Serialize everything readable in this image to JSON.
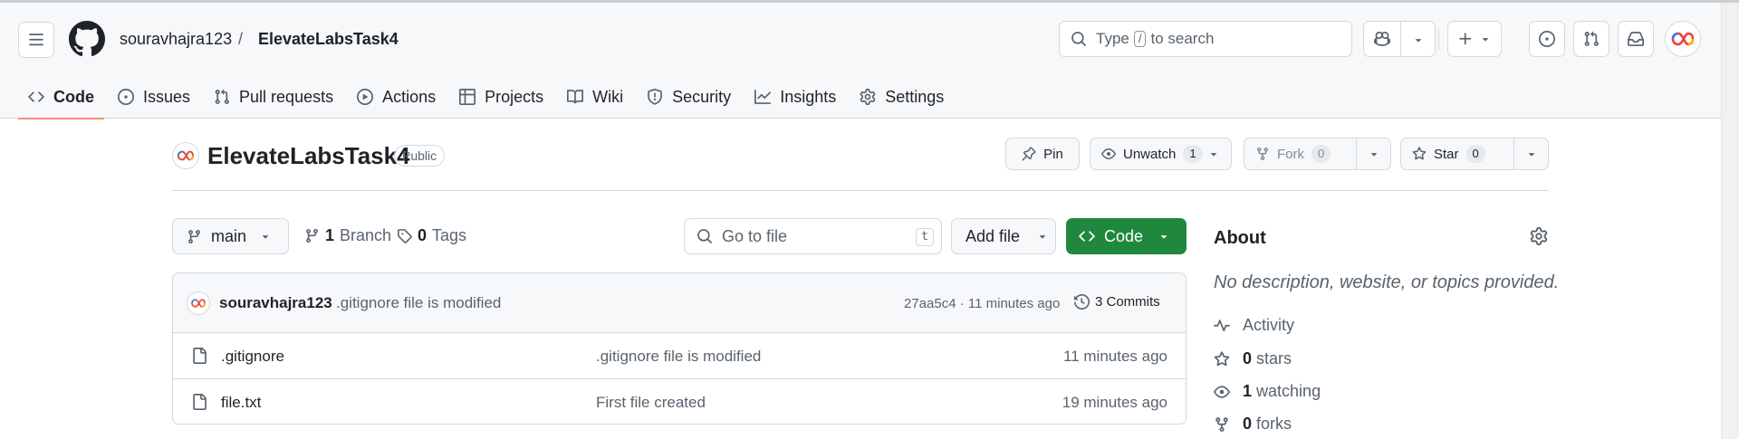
{
  "header": {
    "owner": "souravhajra123",
    "separator": "/",
    "repo": "ElevateLabsTask4",
    "search_prefix": "Type",
    "search_key": "/",
    "search_suffix": "to search"
  },
  "tabs": [
    {
      "label": "Code",
      "icon": "code-icon",
      "selected": true
    },
    {
      "label": "Issues",
      "icon": "issue-opened-icon"
    },
    {
      "label": "Pull requests",
      "icon": "git-pull-request-icon"
    },
    {
      "label": "Actions",
      "icon": "play-icon"
    },
    {
      "label": "Projects",
      "icon": "table-icon"
    },
    {
      "label": "Wiki",
      "icon": "book-icon"
    },
    {
      "label": "Security",
      "icon": "shield-icon"
    },
    {
      "label": "Insights",
      "icon": "graph-icon"
    },
    {
      "label": "Settings",
      "icon": "gear-icon"
    }
  ],
  "repo_header": {
    "title": "ElevateLabsTask4",
    "visibility": "Public",
    "pin_label": "Pin",
    "watch_label": "Unwatch",
    "watch_count": "1",
    "fork_label": "Fork",
    "fork_count": "0",
    "star_label": "Star",
    "star_count": "0"
  },
  "file_nav": {
    "branch": "main",
    "branch_count": "1",
    "branch_label": "Branch",
    "tag_count": "0",
    "tag_label": "Tags",
    "goto_placeholder": "Go to file",
    "goto_key": "t",
    "add_file_label": "Add file",
    "code_label": "Code"
  },
  "latest_commit": {
    "author": "souravhajra123",
    "message": ".gitignore file is modified",
    "meta": "27aa5c4 · 11 minutes ago",
    "commits_label": "3 Commits"
  },
  "files": [
    {
      "name": ".gitignore",
      "message": ".gitignore file is modified",
      "age": "11 minutes ago"
    },
    {
      "name": "file.txt",
      "message": "First file created",
      "age": "19 minutes ago"
    }
  ],
  "about": {
    "title": "About",
    "description": "No description, website, or topics provided.",
    "activity_label": "Activity",
    "stars_count": "0",
    "stars_label": "stars",
    "watching_count": "1",
    "watching_label": "watching",
    "forks_count": "0",
    "forks_label": "forks"
  },
  "colors": {
    "accent_underline": "#fd8c73",
    "primary_button": "#1f883d",
    "header_bg": "#f6f8fa",
    "border": "#d1d9e0"
  }
}
